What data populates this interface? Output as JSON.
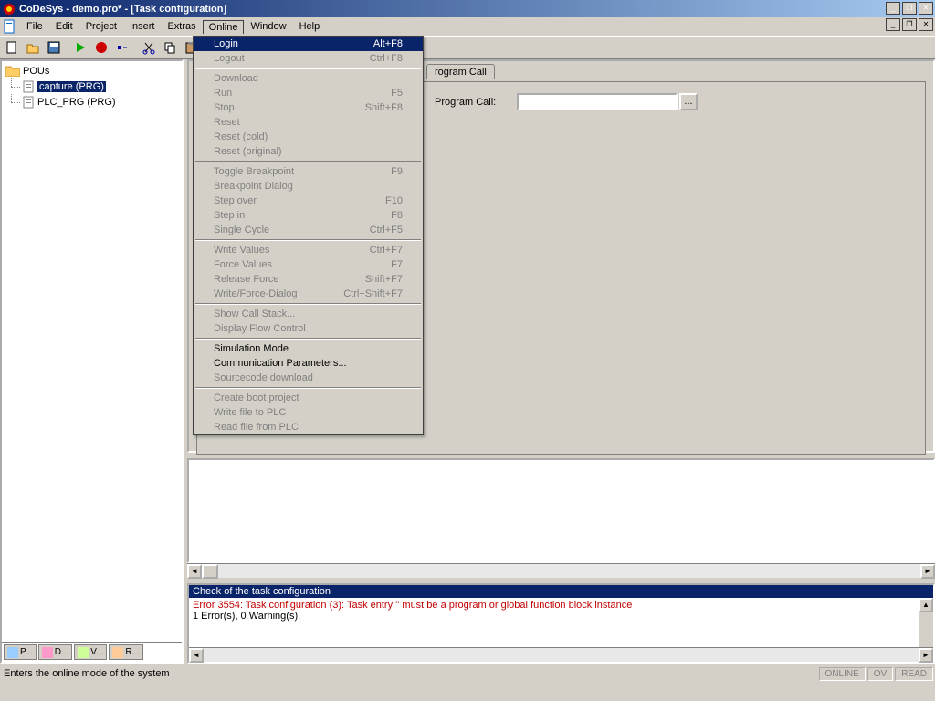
{
  "title": "CoDeSys - demo.pro* - [Task configuration]",
  "menubar": [
    "File",
    "Edit",
    "Project",
    "Insert",
    "Extras",
    "Online",
    "Window",
    "Help"
  ],
  "menu_active_index": 5,
  "tree": {
    "root": "POUs",
    "items": [
      {
        "label": "capture (PRG)",
        "selected": true
      },
      {
        "label": "PLC_PRG (PRG)",
        "selected": false
      }
    ]
  },
  "left_tabs": [
    "P...",
    "D...",
    "V...",
    "R..."
  ],
  "right": {
    "tab_visible_part": "rogram Call",
    "label": "Program Call:",
    "browse": "..."
  },
  "messages": {
    "header": "Check of the task configuration",
    "error": "Error 3554: Task configuration (3): Task entry '' must be a program or global function block instance",
    "summary": "1 Error(s), 0 Warning(s)."
  },
  "status": {
    "hint": "Enters the online mode of the system",
    "cells": [
      "ONLINE",
      "OV",
      "READ"
    ]
  },
  "dropdown": [
    {
      "label": "Login",
      "shortcut": "Alt+F8",
      "hl": true
    },
    {
      "label": "Logout",
      "shortcut": "Ctrl+F8",
      "dis": true
    },
    {
      "sep": true
    },
    {
      "label": "Download",
      "dis": true
    },
    {
      "label": "Run",
      "shortcut": "F5",
      "dis": true
    },
    {
      "label": "Stop",
      "shortcut": "Shift+F8",
      "dis": true
    },
    {
      "label": "Reset",
      "dis": true
    },
    {
      "label": "Reset (cold)",
      "dis": true
    },
    {
      "label": "Reset (original)",
      "dis": true
    },
    {
      "sep": true
    },
    {
      "label": "Toggle Breakpoint",
      "shortcut": "F9",
      "dis": true
    },
    {
      "label": "Breakpoint Dialog",
      "dis": true
    },
    {
      "label": "Step over",
      "shortcut": "F10",
      "dis": true
    },
    {
      "label": "Step in",
      "shortcut": "F8",
      "dis": true
    },
    {
      "label": "Single Cycle",
      "shortcut": "Ctrl+F5",
      "dis": true
    },
    {
      "sep": true
    },
    {
      "label": "Write Values",
      "shortcut": "Ctrl+F7",
      "dis": true
    },
    {
      "label": "Force Values",
      "shortcut": "F7",
      "dis": true
    },
    {
      "label": "Release Force",
      "shortcut": "Shift+F7",
      "dis": true
    },
    {
      "label": "Write/Force-Dialog",
      "shortcut": "Ctrl+Shift+F7",
      "dis": true
    },
    {
      "sep": true
    },
    {
      "label": "Show Call Stack...",
      "dis": true
    },
    {
      "label": "Display Flow Control",
      "dis": true
    },
    {
      "sep": true
    },
    {
      "label": "Simulation Mode"
    },
    {
      "label": "Communication Parameters..."
    },
    {
      "label": "Sourcecode download",
      "dis": true
    },
    {
      "sep": true
    },
    {
      "label": "Create boot project",
      "dis": true
    },
    {
      "label": "Write file to PLC",
      "dis": true
    },
    {
      "label": "Read file from PLC",
      "dis": true
    }
  ]
}
